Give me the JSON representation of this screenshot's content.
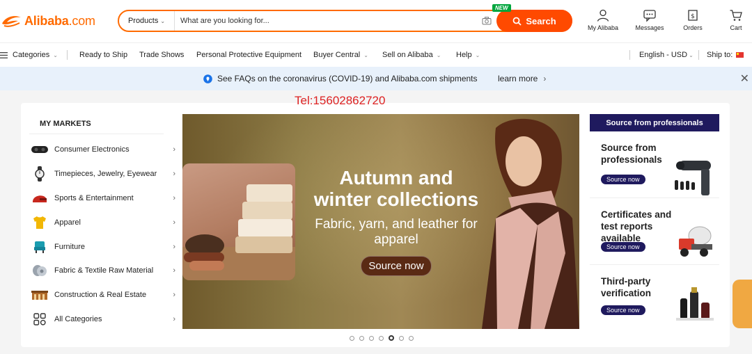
{
  "header": {
    "logo_main": "Alibaba",
    "logo_suffix": ".com",
    "search": {
      "category": "Products",
      "placeholder": "What are you looking for...",
      "button_label": "Search",
      "new_badge": "NEW"
    },
    "actions": [
      {
        "label": "My Alibaba",
        "icon": "user-icon"
      },
      {
        "label": "Messages",
        "icon": "messages-icon"
      },
      {
        "label": "Orders",
        "icon": "orders-icon"
      },
      {
        "label": "Cart",
        "icon": "cart-icon"
      }
    ]
  },
  "nav": {
    "categories": "Categories",
    "ready_to_ship": "Ready to Ship",
    "trade_shows": "Trade Shows",
    "ppe": "Personal Protective Equipment",
    "buyer_central": "Buyer Central",
    "sell_on_alibaba": "Sell on Alibaba",
    "help": "Help",
    "language": "English - USD",
    "ship_to": "Ship to:"
  },
  "notice": {
    "message": "See FAQs on the coronavirus (COVID-19) and Alibaba.com shipments",
    "link": "learn more"
  },
  "watermark": "Tel:15602862720",
  "markets": {
    "title": "MY MARKETS",
    "items": [
      {
        "label": "Consumer Electronics",
        "icon": "vr-headset-icon"
      },
      {
        "label": "Timepieces, Jewelry, Eyewear",
        "icon": "watch-icon"
      },
      {
        "label": "Sports & Entertainment",
        "icon": "helmet-icon"
      },
      {
        "label": "Apparel",
        "icon": "shirt-icon"
      },
      {
        "label": "Furniture",
        "icon": "chair-icon"
      },
      {
        "label": "Fabric & Textile Raw Material",
        "icon": "fabric-icon"
      },
      {
        "label": "Construction & Real Estate",
        "icon": "building-icon"
      },
      {
        "label": "All Categories",
        "icon": "grid-icon"
      }
    ]
  },
  "banner": {
    "title": "Autumn and winter collections",
    "subtitle": "Fabric, yarn, and leather for apparel",
    "cta": "Source now",
    "slide_count": 7,
    "active_slide": 5
  },
  "pros": {
    "header": "Source from professionals",
    "cards": [
      {
        "title": "Source from professionals",
        "button": "Source now",
        "icon": "massage-gun-icon"
      },
      {
        "title": "Certificates and test reports available",
        "button": "Source now",
        "icon": "mixer-truck-icon"
      },
      {
        "title": "Third-party verification",
        "button": "Source now",
        "icon": "cosmetics-icon"
      }
    ]
  },
  "colors": {
    "brand_orange": "#ff6a00",
    "navy": "#1f1a5e",
    "notice_bg": "#e8f1fb"
  }
}
